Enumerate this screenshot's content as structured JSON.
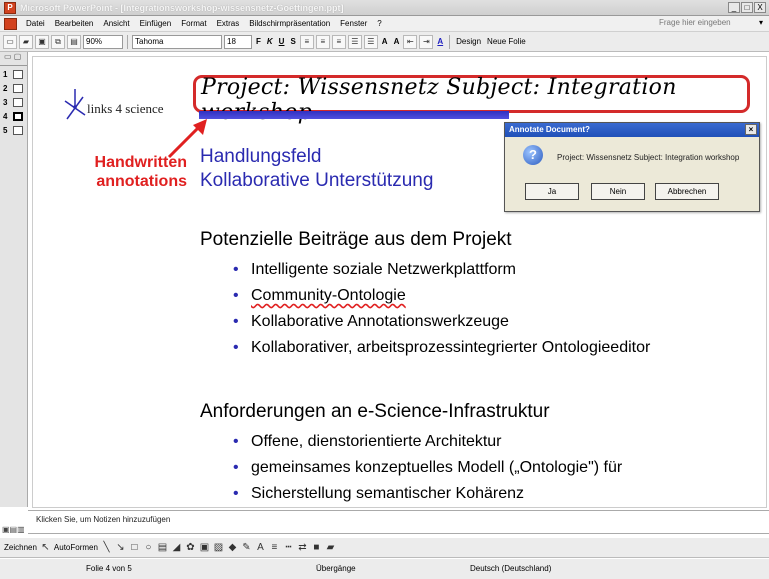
{
  "window": {
    "title": "Microsoft PowerPoint - [Integrationsworkshop-wissensnetz-Goettingen.ppt]",
    "controls": [
      "_",
      "□",
      "X"
    ]
  },
  "menubar": {
    "items": [
      "Datei",
      "Bearbeiten",
      "Ansicht",
      "Einfügen",
      "Format",
      "Extras",
      "Bildschirmpräsentation",
      "Fenster",
      "?"
    ],
    "help_placeholder": "Frage hier eingeben"
  },
  "toolbar": {
    "zoom": "90%",
    "font": "Tahoma",
    "size": "18",
    "design_label": "Design",
    "new_slide_label": "Neue Folie"
  },
  "slides_panel": {
    "numbers": [
      "1",
      "2",
      "3",
      "4",
      "5"
    ],
    "active": 4
  },
  "slide": {
    "logo_text": "links 4 science",
    "handwritten": "Project: Wissensnetz   Subject: Integration workshop",
    "annotation_label_line1": "Handwritten",
    "annotation_label_line2": "annotations",
    "heading_line1": "Handlungsfeld",
    "heading_line2": "Kollaborative Unterstützung",
    "section1_title": "Potenzielle Beiträge aus dem Projekt",
    "section1_bullets": [
      "Intelligente soziale Netzwerkplattform",
      "Community-Ontologie",
      "Kollaborative Annotationswerkzeuge",
      "Kollaborativer, arbeitsprozessintegrierter Ontologieeditor"
    ],
    "section2_title": "Anforderungen an e-Science-Infrastruktur",
    "section2_bullets": [
      "Offene, dienstorientierte Architektur",
      "gemeinsames konzeptuelles Modell („Ontologie\") für",
      "Sicherstellung semantischer Kohärenz"
    ]
  },
  "dialog": {
    "title": "Annotate Document?",
    "message": "Project: Wissensnetz Subject: Integration workshop",
    "yes": "Ja",
    "no": "Nein",
    "cancel": "Abbrechen"
  },
  "notes": {
    "placeholder": "Klicken Sie, um Notizen hinzuzufügen"
  },
  "drawing_toolbar": {
    "draw_label": "Zeichnen",
    "autoshapes_label": "AutoFormen"
  },
  "statusbar": {
    "slide_info": "Folie 4 von 5",
    "design_name": "Übergänge",
    "language": "Deutsch (Deutschland)"
  },
  "colors": {
    "annotation_red": "#d42a2a",
    "heading_blue": "#2a2ab0",
    "dialog_title_blue": "#2050b8"
  }
}
